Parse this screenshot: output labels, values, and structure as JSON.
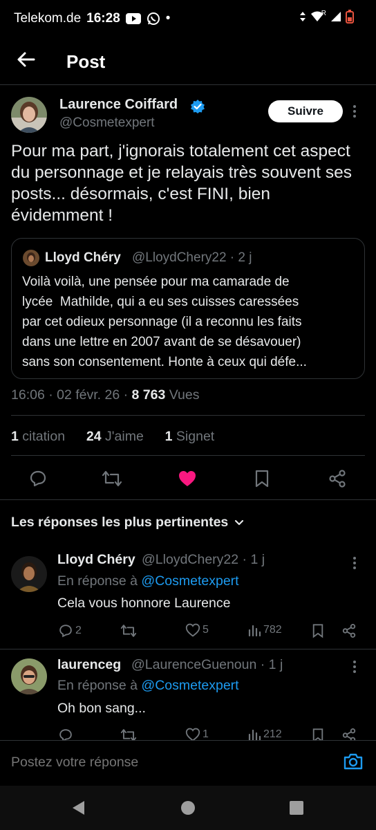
{
  "status_bar": {
    "carrier": "Telekom.de",
    "time": "16:28",
    "dot": "•",
    "sim_label": "R"
  },
  "header": {
    "title": "Post"
  },
  "post": {
    "author_name": "Laurence Coiffard",
    "author_handle": "@Cosmetexpert",
    "follow_label": "Suivre",
    "text": "Pour ma part, j'ignorais totalement cet aspect du personnage et je relayais très souvent ses posts... désormais, c'est FINI, bien évidemment !",
    "quote": {
      "name": "Lloyd Chéry",
      "meta": "@LloydChery22 · 2 j",
      "lines": [
        "Voilà voilà, une pensée pour ma camarade de",
        "lycée  Mathilde, qui a eu ses cuisses caressées",
        "par cet odieux personnage (il a reconnu les faits",
        "dans une lettre en 2007 avant de se désavouer)",
        "sans son consentement. Honte à ceux qui défe..."
      ]
    },
    "timestamp": "16:06 · 02 févr. 26 · ",
    "views_count": "8 763",
    "views_label": " Vues",
    "stats": {
      "quotes_count": "1",
      "quotes_label": "citation",
      "likes_count": "24",
      "likes_label": "J'aime",
      "bookmarks_count": "1",
      "bookmarks_label": "Signet"
    }
  },
  "sort_label": "Les réponses les plus pertinentes",
  "replies": [
    {
      "name": "Lloyd Chéry",
      "meta": "@LloydChery22 · 1 j",
      "reply_prefix": "En réponse à ",
      "reply_handle": "@Cosmetexpert",
      "text": "Cela vous honnore Laurence",
      "comments": "2",
      "reposts": "",
      "likes": "5",
      "views": "782"
    },
    {
      "name": "laurenceg",
      "meta": "@LaurenceGuenoun · 1 j",
      "reply_prefix": "En réponse à ",
      "reply_handle": "@Cosmetexpert",
      "text": "Oh bon sang...",
      "comments": "",
      "reposts": "",
      "likes": "1",
      "views": "212"
    }
  ],
  "compose": {
    "placeholder": "Postez votre réponse"
  },
  "colors": {
    "background": "#000000",
    "text": "#e7e9ea",
    "muted": "#71767b",
    "accent_blue": "#1d9bf0",
    "like_pink": "#f91880"
  },
  "icons": [
    "back-arrow-icon",
    "verified-badge-icon",
    "more-icon",
    "comment-icon",
    "repost-icon",
    "heart-filled-icon",
    "bookmark-icon",
    "share-icon",
    "chevron-down-icon",
    "views-icon",
    "camera-icon",
    "nav-back-icon",
    "nav-home-icon",
    "nav-recents-icon"
  ]
}
